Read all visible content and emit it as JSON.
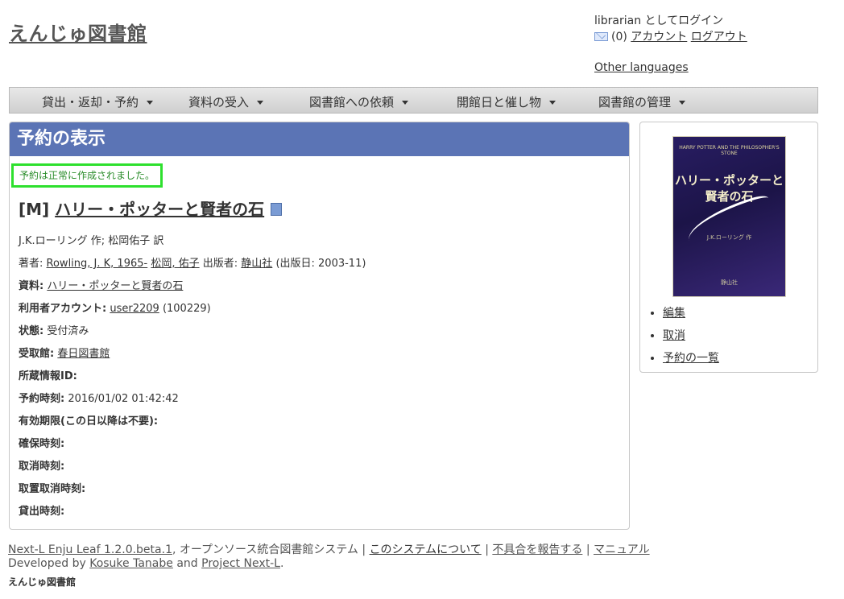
{
  "site": {
    "title": "えんじゅ図書館"
  },
  "account": {
    "login_text": "librarian としてログイン",
    "mail_count": "(0)",
    "account_link": "アカウント",
    "logout_link": "ログアウト",
    "other_languages": "Other languages"
  },
  "nav": {
    "items": [
      {
        "label": "貸出・返却・予約"
      },
      {
        "label": "資料の受入"
      },
      {
        "label": "図書館への依頼"
      },
      {
        "label": "開館日と催し物"
      },
      {
        "label": "図書館の管理"
      }
    ]
  },
  "main": {
    "header": "予約の表示",
    "notice": "予約は正常に作成されました。",
    "title_prefix": "[M]",
    "title": "ハリー・ポッターと賢者の石",
    "creators": "J.K.ローリング 作; 松岡佑子 訳",
    "authors_label": "著者:",
    "author1": "Rowling, J. K, 1965-",
    "author2": "松岡, 佑子",
    "publisher_label": "出版者:",
    "publisher": "静山社",
    "pub_date": "(出版日: 2003-11)",
    "fields": {
      "resource_label": "資料:",
      "resource_value": "ハリー・ポッターと賢者の石",
      "user_label": "利用者アカウント:",
      "user_value": "user2209",
      "user_number": "(100229)",
      "state_label": "状態:",
      "state_value": "受付済み",
      "pickup_label": "受取館:",
      "pickup_value": "春日図書館",
      "item_id_label": "所蔵情報ID:",
      "reserved_at_label": "予約時刻:",
      "reserved_at_value": "2016/01/02 01:42:42",
      "expire_label": "有効期限(この日以降は不要):",
      "retained_label": "確保時刻:",
      "canceled_label": "取消時刻:",
      "postponed_label": "取置取消時刻:",
      "checked_out_label": "貸出時刻:"
    }
  },
  "side": {
    "cover": {
      "top_text": "HARRY POTTER AND THE PHILOSOPHER'S STONE",
      "title_line1": "ハリー・ポッターと",
      "title_line2": "賢者の石",
      "author": "J.K.ローリング 作",
      "publisher": "静山社"
    },
    "links": [
      "編集",
      "取消",
      "予約の一覧"
    ]
  },
  "footer": {
    "enju_link": "Next-L Enju Leaf 1.2.0.beta.1",
    "enju_desc": ", オープンソース統合図書館システム",
    "sep": "|",
    "about": "このシステムについて",
    "report": "不具合を報告する",
    "manual": "マニュアル",
    "developed_by": "Developed by",
    "dev_name": "Kosuke Tanabe",
    "and": "and",
    "project": "Project Next-L",
    "period": ".",
    "brand": "えんじゅ図書館"
  }
}
